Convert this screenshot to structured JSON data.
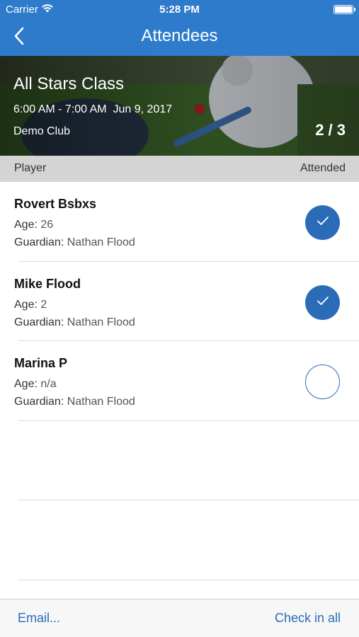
{
  "status_bar": {
    "carrier": "Carrier",
    "wifi_icon": "wifi-icon",
    "time": "5:28 PM",
    "battery_icon": "battery-icon"
  },
  "nav": {
    "back_icon": "chevron-left-icon",
    "title": "Attendees"
  },
  "banner": {
    "class_name": "All Stars Class",
    "time_range": "6:00 AM - 7:00 AM  Jun 9, 2017",
    "club": "Demo Club",
    "attendance_count": "2 / 3"
  },
  "columns": {
    "player": "Player",
    "attended": "Attended"
  },
  "labels": {
    "age": "Age:",
    "guardian": "Guardian:"
  },
  "players": [
    {
      "name": "Rovert Bsbxs",
      "age": "26",
      "guardian": "Nathan Flood",
      "attended": true
    },
    {
      "name": "Mike Flood",
      "age": "2",
      "guardian": "Nathan Flood",
      "attended": true
    },
    {
      "name": "Marina P",
      "age": "n/a",
      "guardian": "Nathan Flood",
      "attended": false
    }
  ],
  "toolbar": {
    "email_label": "Email...",
    "check_in_all_label": "Check in all"
  },
  "colors": {
    "nav_blue": "#2e7bcc",
    "check_blue": "#2a6cb8",
    "header_grey": "#d4d4d4"
  }
}
